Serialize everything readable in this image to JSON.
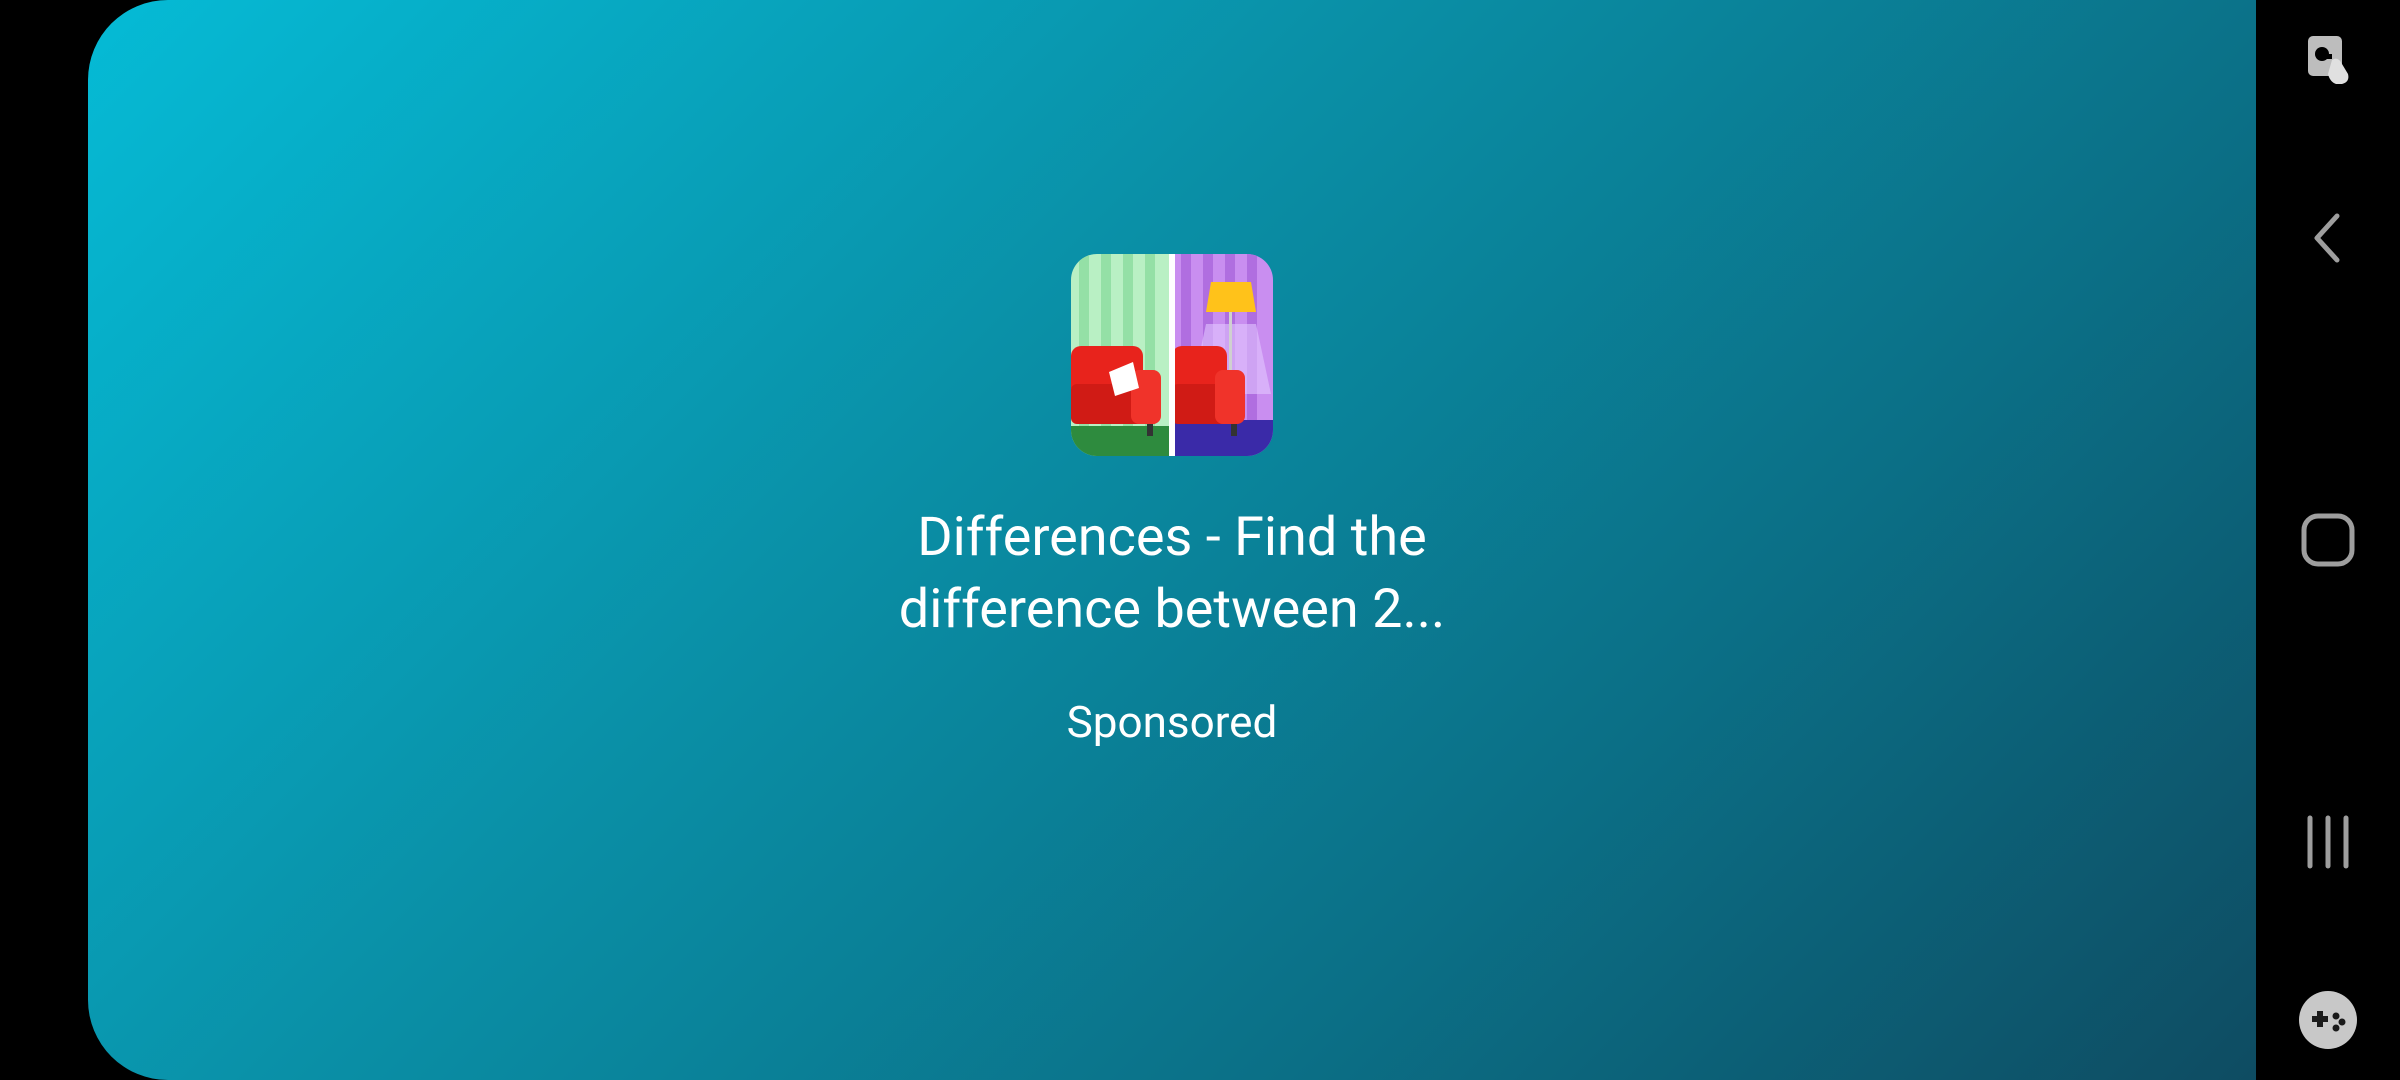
{
  "ad": {
    "app_name_line1": "Differences - Find the",
    "app_name_line2": "difference between 2...",
    "sponsored_label": "Sponsored",
    "icon": "differences-app-icon",
    "background_gradient": [
      "#05bbd6",
      "#0e4c62"
    ]
  },
  "nav_bar": {
    "buttons": [
      {
        "name": "accessibility-touch-icon"
      },
      {
        "name": "back-icon"
      },
      {
        "name": "home-icon"
      },
      {
        "name": "recents-icon"
      },
      {
        "name": "game-tools-icon"
      }
    ],
    "icon_color": "#9e9e9e"
  }
}
